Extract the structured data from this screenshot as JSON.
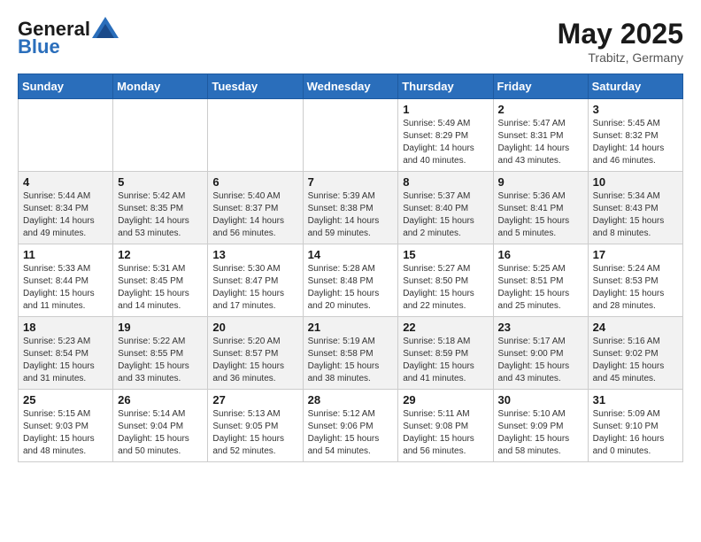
{
  "header": {
    "logo_text_general": "General",
    "logo_text_blue": "Blue",
    "month": "May 2025",
    "location": "Trabitz, Germany"
  },
  "weekdays": [
    "Sunday",
    "Monday",
    "Tuesday",
    "Wednesday",
    "Thursday",
    "Friday",
    "Saturday"
  ],
  "weeks": [
    [
      {
        "day": "",
        "info": ""
      },
      {
        "day": "",
        "info": ""
      },
      {
        "day": "",
        "info": ""
      },
      {
        "day": "",
        "info": ""
      },
      {
        "day": "1",
        "info": "Sunrise: 5:49 AM\nSunset: 8:29 PM\nDaylight: 14 hours\nand 40 minutes."
      },
      {
        "day": "2",
        "info": "Sunrise: 5:47 AM\nSunset: 8:31 PM\nDaylight: 14 hours\nand 43 minutes."
      },
      {
        "day": "3",
        "info": "Sunrise: 5:45 AM\nSunset: 8:32 PM\nDaylight: 14 hours\nand 46 minutes."
      }
    ],
    [
      {
        "day": "4",
        "info": "Sunrise: 5:44 AM\nSunset: 8:34 PM\nDaylight: 14 hours\nand 49 minutes."
      },
      {
        "day": "5",
        "info": "Sunrise: 5:42 AM\nSunset: 8:35 PM\nDaylight: 14 hours\nand 53 minutes."
      },
      {
        "day": "6",
        "info": "Sunrise: 5:40 AM\nSunset: 8:37 PM\nDaylight: 14 hours\nand 56 minutes."
      },
      {
        "day": "7",
        "info": "Sunrise: 5:39 AM\nSunset: 8:38 PM\nDaylight: 14 hours\nand 59 minutes."
      },
      {
        "day": "8",
        "info": "Sunrise: 5:37 AM\nSunset: 8:40 PM\nDaylight: 15 hours\nand 2 minutes."
      },
      {
        "day": "9",
        "info": "Sunrise: 5:36 AM\nSunset: 8:41 PM\nDaylight: 15 hours\nand 5 minutes."
      },
      {
        "day": "10",
        "info": "Sunrise: 5:34 AM\nSunset: 8:43 PM\nDaylight: 15 hours\nand 8 minutes."
      }
    ],
    [
      {
        "day": "11",
        "info": "Sunrise: 5:33 AM\nSunset: 8:44 PM\nDaylight: 15 hours\nand 11 minutes."
      },
      {
        "day": "12",
        "info": "Sunrise: 5:31 AM\nSunset: 8:45 PM\nDaylight: 15 hours\nand 14 minutes."
      },
      {
        "day": "13",
        "info": "Sunrise: 5:30 AM\nSunset: 8:47 PM\nDaylight: 15 hours\nand 17 minutes."
      },
      {
        "day": "14",
        "info": "Sunrise: 5:28 AM\nSunset: 8:48 PM\nDaylight: 15 hours\nand 20 minutes."
      },
      {
        "day": "15",
        "info": "Sunrise: 5:27 AM\nSunset: 8:50 PM\nDaylight: 15 hours\nand 22 minutes."
      },
      {
        "day": "16",
        "info": "Sunrise: 5:25 AM\nSunset: 8:51 PM\nDaylight: 15 hours\nand 25 minutes."
      },
      {
        "day": "17",
        "info": "Sunrise: 5:24 AM\nSunset: 8:53 PM\nDaylight: 15 hours\nand 28 minutes."
      }
    ],
    [
      {
        "day": "18",
        "info": "Sunrise: 5:23 AM\nSunset: 8:54 PM\nDaylight: 15 hours\nand 31 minutes."
      },
      {
        "day": "19",
        "info": "Sunrise: 5:22 AM\nSunset: 8:55 PM\nDaylight: 15 hours\nand 33 minutes."
      },
      {
        "day": "20",
        "info": "Sunrise: 5:20 AM\nSunset: 8:57 PM\nDaylight: 15 hours\nand 36 minutes."
      },
      {
        "day": "21",
        "info": "Sunrise: 5:19 AM\nSunset: 8:58 PM\nDaylight: 15 hours\nand 38 minutes."
      },
      {
        "day": "22",
        "info": "Sunrise: 5:18 AM\nSunset: 8:59 PM\nDaylight: 15 hours\nand 41 minutes."
      },
      {
        "day": "23",
        "info": "Sunrise: 5:17 AM\nSunset: 9:00 PM\nDaylight: 15 hours\nand 43 minutes."
      },
      {
        "day": "24",
        "info": "Sunrise: 5:16 AM\nSunset: 9:02 PM\nDaylight: 15 hours\nand 45 minutes."
      }
    ],
    [
      {
        "day": "25",
        "info": "Sunrise: 5:15 AM\nSunset: 9:03 PM\nDaylight: 15 hours\nand 48 minutes."
      },
      {
        "day": "26",
        "info": "Sunrise: 5:14 AM\nSunset: 9:04 PM\nDaylight: 15 hours\nand 50 minutes."
      },
      {
        "day": "27",
        "info": "Sunrise: 5:13 AM\nSunset: 9:05 PM\nDaylight: 15 hours\nand 52 minutes."
      },
      {
        "day": "28",
        "info": "Sunrise: 5:12 AM\nSunset: 9:06 PM\nDaylight: 15 hours\nand 54 minutes."
      },
      {
        "day": "29",
        "info": "Sunrise: 5:11 AM\nSunset: 9:08 PM\nDaylight: 15 hours\nand 56 minutes."
      },
      {
        "day": "30",
        "info": "Sunrise: 5:10 AM\nSunset: 9:09 PM\nDaylight: 15 hours\nand 58 minutes."
      },
      {
        "day": "31",
        "info": "Sunrise: 5:09 AM\nSunset: 9:10 PM\nDaylight: 16 hours\nand 0 minutes."
      }
    ]
  ]
}
